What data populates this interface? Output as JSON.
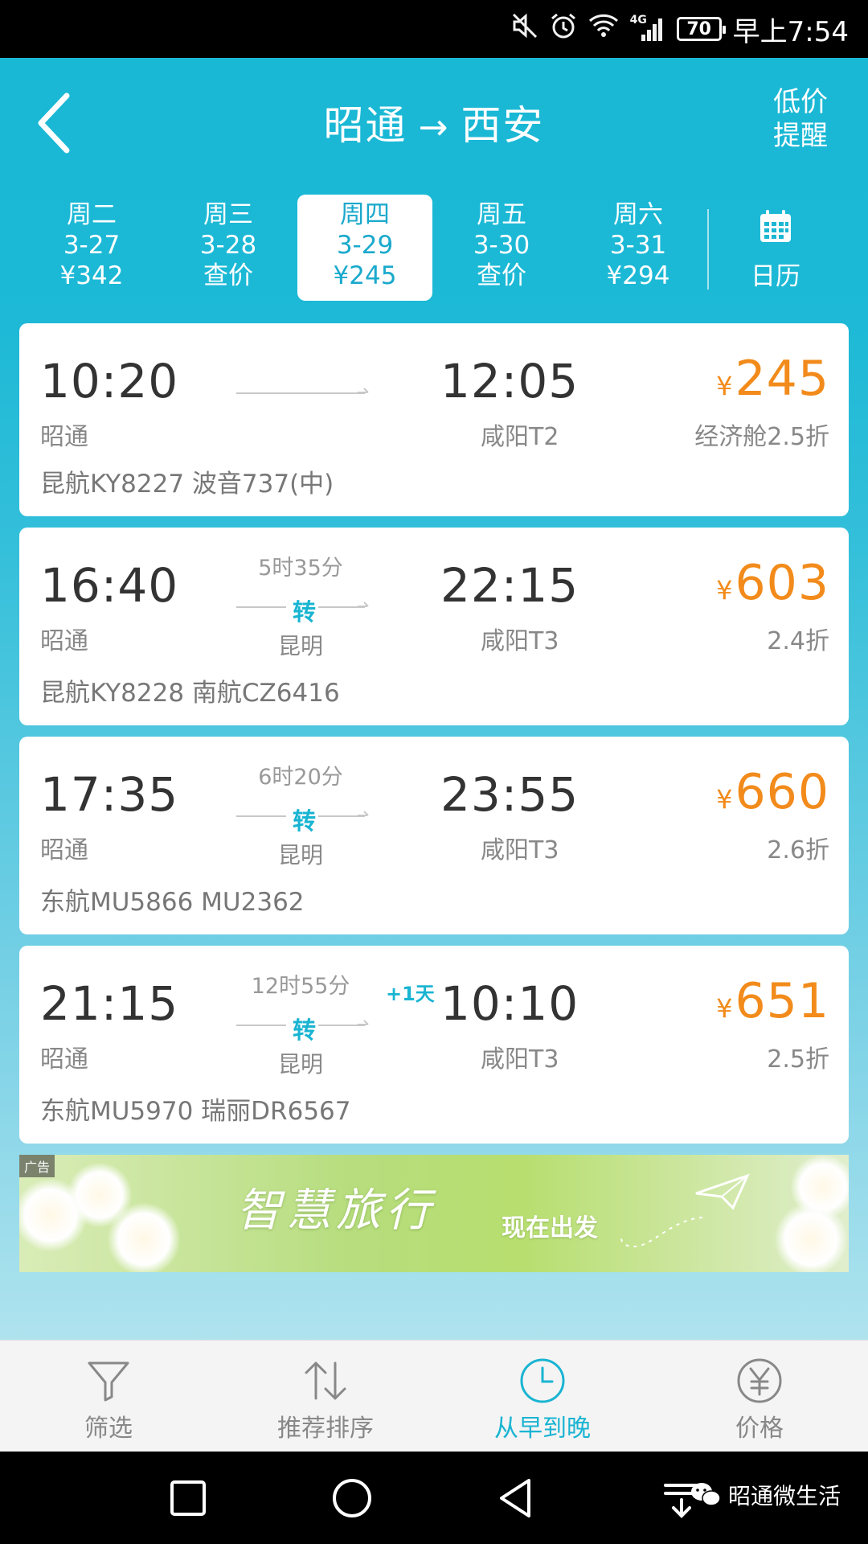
{
  "status_bar": {
    "network": "4G",
    "battery": "70",
    "time": "早上7:54"
  },
  "header": {
    "from": "昭通",
    "arrow": "→",
    "to": "西安",
    "lowprice_line1": "低价",
    "lowprice_line2": "提醒"
  },
  "date_tabs": [
    {
      "weekday": "周二",
      "date": "3-27",
      "price": "¥342"
    },
    {
      "weekday": "周三",
      "date": "3-28",
      "price": "查价"
    },
    {
      "weekday": "周四",
      "date": "3-29",
      "price": "¥245"
    },
    {
      "weekday": "周五",
      "date": "3-30",
      "price": "查价"
    },
    {
      "weekday": "周六",
      "date": "3-31",
      "price": "¥294"
    }
  ],
  "calendar_label": "日历",
  "flights": [
    {
      "dep_time": "10:20",
      "arr_time": "12:05",
      "dep_city": "昭通",
      "arr_city": "咸阳T2",
      "currency": "¥",
      "price": "245",
      "discount": "经济舱2.5折",
      "flight_no": "昆航KY8227 波音737(中)"
    },
    {
      "dep_time": "16:40",
      "arr_time": "22:15",
      "dep_city": "昭通",
      "arr_city": "咸阳T3",
      "duration": "5时35分",
      "stop_badge": "转",
      "stop_city": "昆明",
      "currency": "¥",
      "price": "603",
      "discount": "2.4折",
      "flight_no": "昆航KY8228 南航CZ6416"
    },
    {
      "dep_time": "17:35",
      "arr_time": "23:55",
      "dep_city": "昭通",
      "arr_city": "咸阳T3",
      "duration": "6时20分",
      "stop_badge": "转",
      "stop_city": "昆明",
      "currency": "¥",
      "price": "660",
      "discount": "2.6折",
      "flight_no": "东航MU5866 MU2362"
    },
    {
      "dep_time": "21:15",
      "arr_time": "10:10",
      "dep_city": "昭通",
      "arr_city": "咸阳T3",
      "duration": "12时55分",
      "stop_badge": "转",
      "stop_city": "昆明",
      "next_day": "+1天",
      "currency": "¥",
      "price": "651",
      "discount": "2.5折",
      "flight_no": "东航MU5970 瑞丽DR6567"
    }
  ],
  "ad": {
    "tag": "广告",
    "title": "智慧旅行",
    "subtitle": "现在出发"
  },
  "tab_bar": [
    {
      "label": "筛选",
      "icon": "filter-icon"
    },
    {
      "label": "推荐排序",
      "icon": "sort-icon"
    },
    {
      "label": "从早到晚",
      "icon": "clock-icon"
    },
    {
      "label": "价格",
      "icon": "yen-icon"
    }
  ],
  "watermark": "昭通微生活",
  "colors": {
    "header_bg": "#19b8d5",
    "accent": "#19b4d2",
    "price": "#f28b1b"
  }
}
